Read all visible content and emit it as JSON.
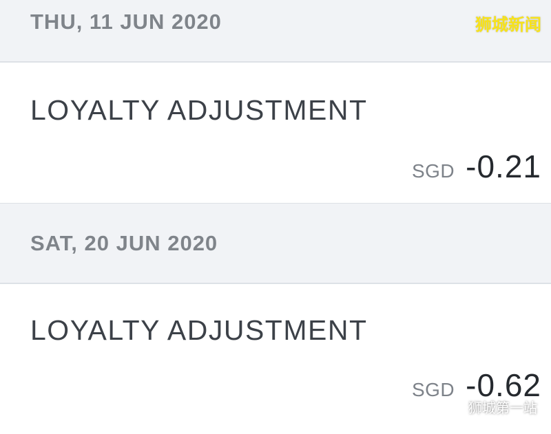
{
  "transactions": [
    {
      "date": "THU, 11 JUN 2020",
      "title": "LOYALTY ADJUSTMENT",
      "currency": "SGD",
      "amount": "-0.21"
    },
    {
      "date": "SAT, 20 JUN 2020",
      "title": "LOYALTY ADJUSTMENT",
      "currency": "SGD",
      "amount": "-0.62"
    }
  ],
  "watermarks": {
    "top_right": "狮城新闻",
    "bottom_right": "狮城第一站"
  },
  "colors": {
    "header_bg": "#f1f3f6",
    "card_bg": "#ffffff",
    "watermark_top": "#f7e21a"
  }
}
